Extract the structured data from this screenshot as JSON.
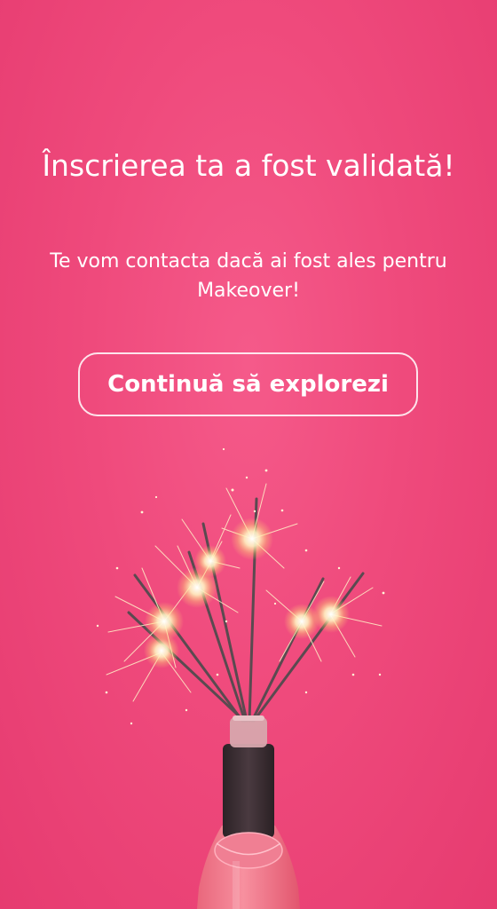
{
  "confirmation": {
    "title": "Înscrierea ta a fost validată!",
    "message": "Te vom contacta dacă ai fost ales pentru Makeover!",
    "continue_label": "Continuă să explorezi"
  },
  "illustration": {
    "subject": "champagne bottle with lit sparklers"
  },
  "colors": {
    "background": "#ef4a7c",
    "text": "#ffffff",
    "button_border": "#ffffff",
    "bottle": "#f27a8c",
    "bottle_neck": "#3b2e32"
  }
}
